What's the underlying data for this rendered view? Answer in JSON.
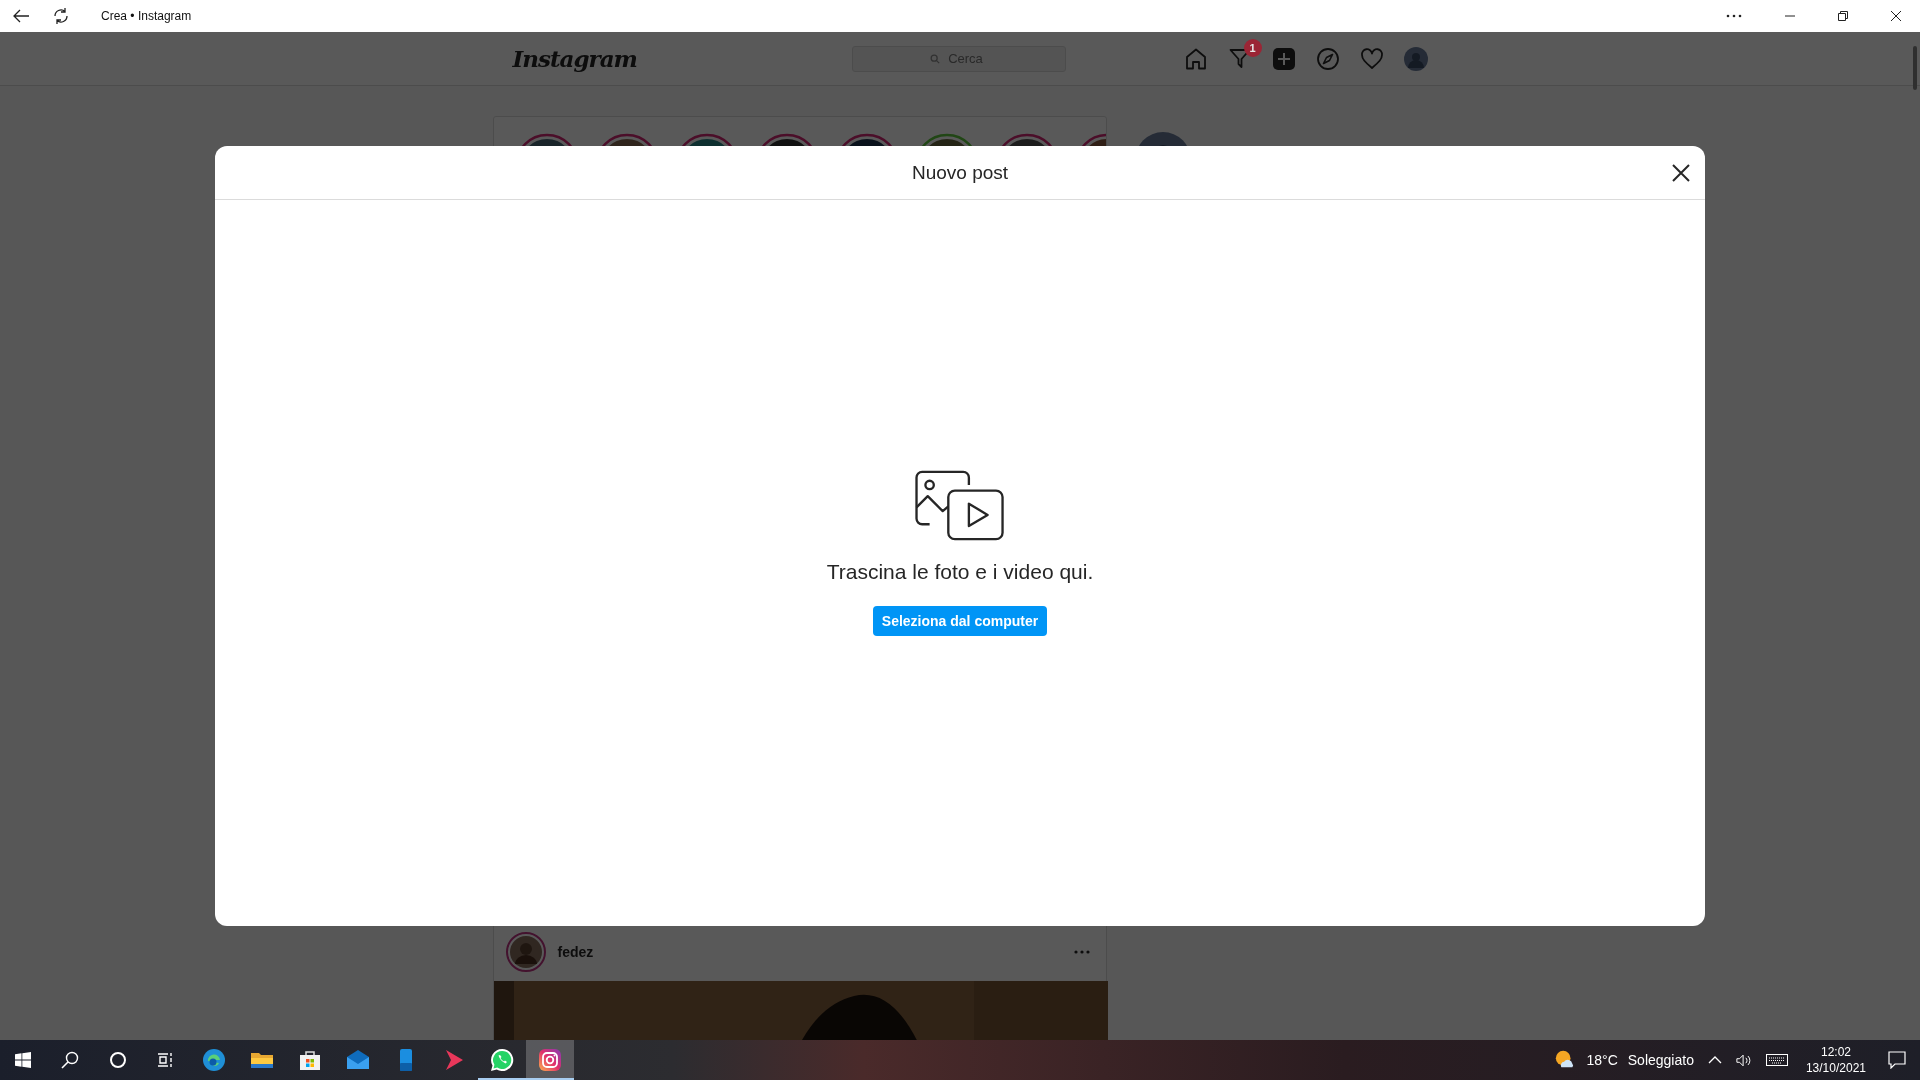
{
  "browser": {
    "title": "Crea • Instagram"
  },
  "nav": {
    "logo": "Instagram",
    "search": {
      "placeholder": "Cerca"
    },
    "direct_badge": "1"
  },
  "stories": [
    {
      "close_friend": false
    },
    {
      "close_friend": false
    },
    {
      "close_friend": false
    },
    {
      "close_friend": false
    },
    {
      "close_friend": false
    },
    {
      "close_friend": true
    },
    {
      "close_friend": false
    },
    {
      "close_friend": false
    }
  ],
  "post": {
    "username": "fedez"
  },
  "modal": {
    "title": "Nuovo post",
    "message": "Trascina le foto e i video qui.",
    "button": "Seleziona dal computer"
  },
  "taskbar": {
    "apps": [
      {
        "kind": "edge",
        "running": false,
        "selected": false
      },
      {
        "kind": "folder",
        "running": false,
        "selected": false
      },
      {
        "kind": "store",
        "running": false,
        "selected": false
      },
      {
        "kind": "mail",
        "running": false,
        "selected": false
      },
      {
        "kind": "phone",
        "running": false,
        "selected": false
      },
      {
        "kind": "play",
        "running": false,
        "selected": false
      },
      {
        "kind": "whatsapp",
        "running": true,
        "selected": false
      },
      {
        "kind": "instagram",
        "running": true,
        "selected": true
      }
    ],
    "temperature": "18°C",
    "weather": "Soleggiato",
    "time": "12:02",
    "date": "13/10/2021"
  }
}
